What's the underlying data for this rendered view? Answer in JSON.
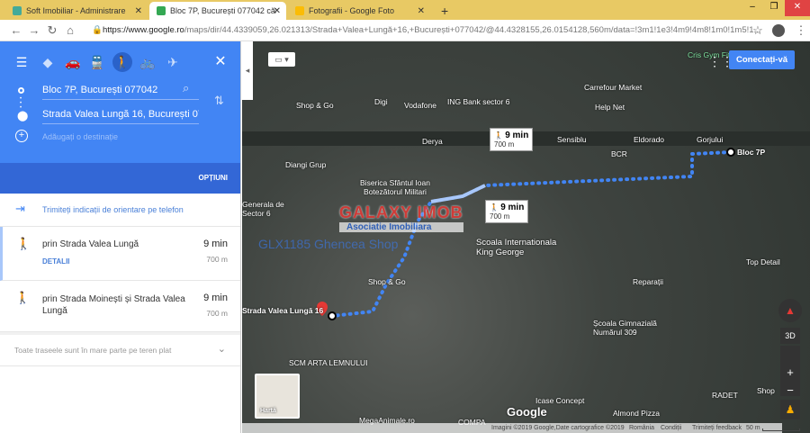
{
  "browser": {
    "tabs": [
      {
        "title": "Soft Imobiliar - Administrare",
        "color": "#4a9"
      },
      {
        "title": "Bloc 7P, București 077042 către S",
        "color": "#34a853"
      },
      {
        "title": "Fotografii - Google Foto",
        "color": "#fbbc05"
      }
    ],
    "url_host": "https://www.google.ro",
    "url_path": "/maps/dir/44.4339059,26.021313/Strada+Valea+Lungă+16,+București+077042/@44.4328155,26.0154128,560m/data=!3m1!1e3!4m9!4m8!1m0!1m5!1..."
  },
  "directions": {
    "origin": "Bloc 7P, București 077042",
    "destination": "Strada Valea Lungă 16, București 077042",
    "add_placeholder": "Adăugați o destinație",
    "options_label": "OPȚIUNI",
    "send_to_phone": "Trimiteți indicații de orientare pe telefon",
    "routes": [
      {
        "via": "prin Strada Valea Lungă",
        "time": "9 min",
        "distance": "700 m",
        "details": "DETALII",
        "selected": true
      },
      {
        "via": "prin Strada Moinești și Strada Valea Lungă",
        "time": "9 min",
        "distance": "700 m",
        "selected": false
      }
    ],
    "note": "Toate traseele sunt în mare parte pe teren plat"
  },
  "map": {
    "sign_in": "Conectați-vă",
    "labels": [
      "Cris Gym Fitness",
      "Carrefour Market",
      "Help Net",
      "ING Bank sector 6",
      "Vodafone",
      "Digi",
      "Shop & Go",
      "Derya",
      "Sensiblu",
      "Eldorado",
      "Gorjului",
      "Bloc 7P",
      "BCR",
      "Diangi Grup",
      "Biserica Sfântul Ioan Botezătorul Militari",
      "Generala de Sector 6",
      "Scoala Internationala King George",
      "Reparații",
      "Școala Gimnazială Numărul 309",
      "Top Detail",
      "Shop & Go",
      "Strada Valea Lungă 16",
      "SCM ARTA LEMNULUI",
      "RADET",
      "Icase Concept",
      "Almond Pizza",
      "MegaAnimale.ro",
      "COMPA",
      "Shop",
      "PC"
    ],
    "route_badges": [
      {
        "time": "9 min",
        "distance": "700 m"
      },
      {
        "time": "9 min",
        "distance": "700 m"
      }
    ],
    "watermark": {
      "brand": "GALAXY IMOB",
      "sub": "Asociatie Imobiliara",
      "code": "GLX1185 Ghencea Shop"
    },
    "layer_label": "Hartă",
    "tilt": "3D",
    "google": "Google",
    "footer": {
      "copyright": "Imagini ©2019 Google,Date cartografice ©2019",
      "country": "România",
      "terms": "Condiții",
      "feedback": "Trimiteți feedback",
      "scale": "50 m"
    },
    "route_color": "#4285f4"
  }
}
